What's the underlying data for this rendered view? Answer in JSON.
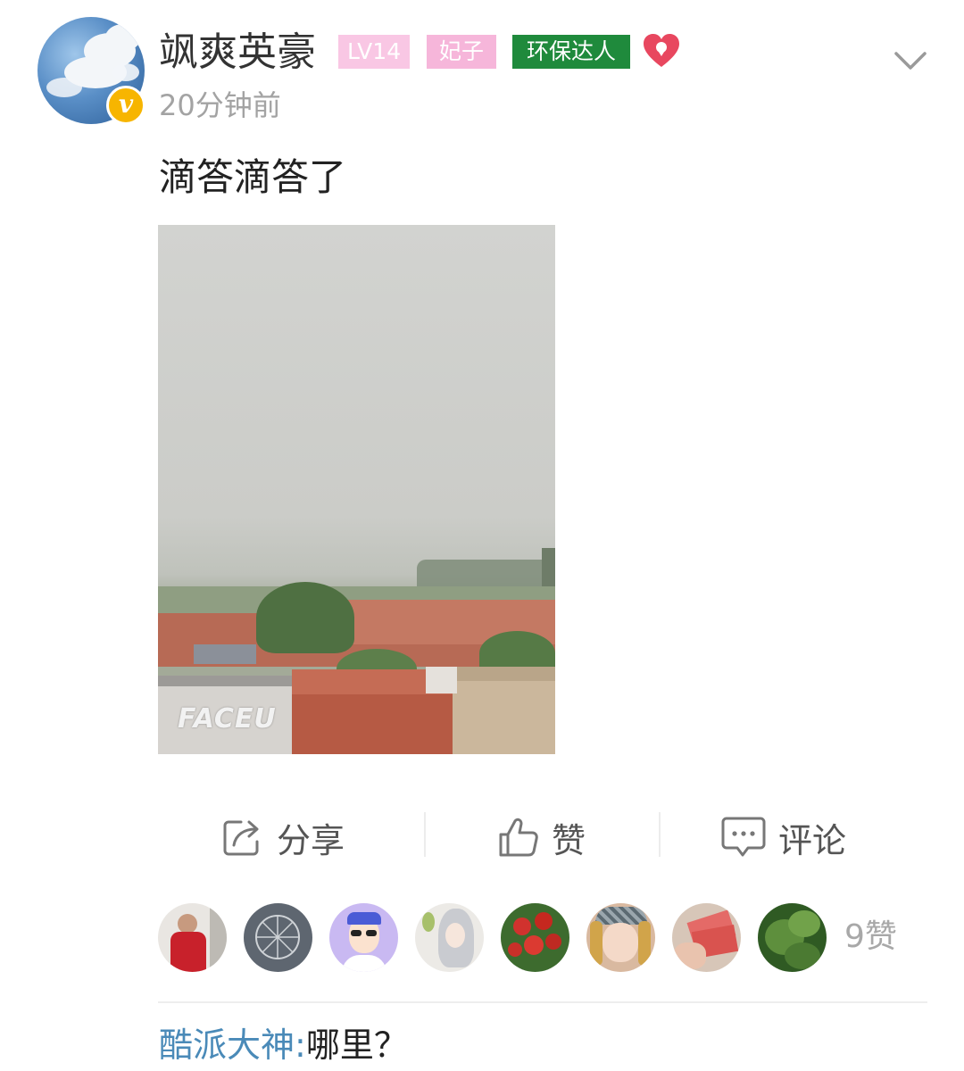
{
  "post": {
    "author": {
      "name": "飒爽英豪",
      "avatar_icon": "cloud-sky-avatar",
      "badge_icon": "v-verified-badge",
      "badge_color": "#f7b500"
    },
    "tags": [
      {
        "label": "LV14",
        "color": "#f9c7e4"
      },
      {
        "label": "妃子",
        "color": "#f6b6da"
      },
      {
        "label": "环保达人",
        "color": "#1f8a3c"
      }
    ],
    "heart_icon": "heart-icon",
    "heart_color": "#e8475f",
    "time": "20分钟前",
    "text": "滴答滴答了",
    "photo": {
      "subject": "rainy-village-rooftops",
      "watermark": "FACEU"
    }
  },
  "actions": {
    "share": {
      "label": "分享",
      "icon": "share-icon"
    },
    "like": {
      "label": "赞",
      "icon": "thumbs-up-icon"
    },
    "comment": {
      "label": "评论",
      "icon": "comment-icon"
    }
  },
  "likes": {
    "avatars": [
      "person-red-avatar",
      "ferris-wheel-avatar",
      "cartoon-sunglasses-avatar",
      "anime-silver-hair-avatar",
      "apples-avatar",
      "woman-cap-avatar",
      "banknotes-avatar",
      "green-leaves-avatar"
    ],
    "count_label": "9赞"
  },
  "comments": [
    {
      "user": "酷派大神",
      "separator": ":",
      "text": "哪里？"
    }
  ],
  "colors": {
    "link": "#4a8ab8",
    "muted": "#a3a3a3",
    "text": "#222222"
  }
}
